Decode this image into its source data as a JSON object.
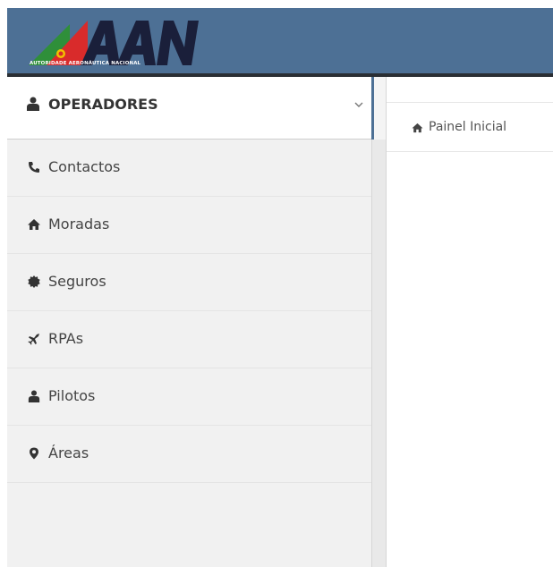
{
  "header": {
    "logo_text": "AAN",
    "logo_subtitle": "AUTORIDADE AERONÁUTICA NACIONAL",
    "bar_color": "#4d7095"
  },
  "sidebar": {
    "active": {
      "label": "OPERADORES",
      "icon": "user-icon",
      "expand_icon": "chevron-down-icon"
    },
    "items": [
      {
        "label": "Contactos",
        "icon": "phone-icon"
      },
      {
        "label": "Moradas",
        "icon": "home-icon"
      },
      {
        "label": "Seguros",
        "icon": "certificate-icon"
      },
      {
        "label": "RPAs",
        "icon": "plane-icon"
      },
      {
        "label": "Pilotos",
        "icon": "user-icon"
      },
      {
        "label": "Áreas",
        "icon": "map-marker-icon"
      }
    ]
  },
  "breadcrumb": {
    "icon": "home-icon",
    "label": "Painel Inicial"
  }
}
